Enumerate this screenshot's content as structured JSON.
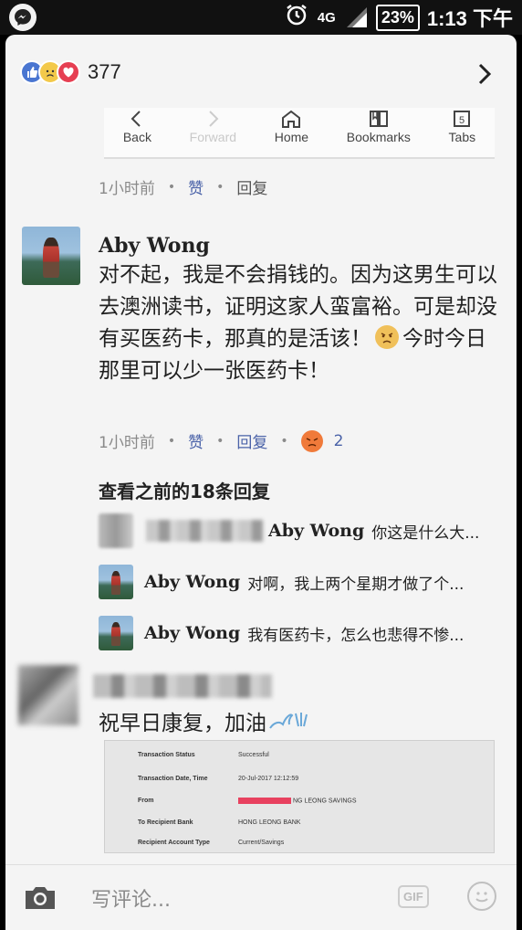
{
  "status_bar": {
    "network": "4G",
    "battery": "23%",
    "time": "1:13 下午"
  },
  "reactions": {
    "count": "377",
    "icons": [
      "like-icon",
      "sad-icon",
      "love-icon"
    ]
  },
  "browser_bar": {
    "back": "Back",
    "forward": "Forward",
    "home": "Home",
    "bookmarks": "Bookmarks",
    "tabs": "Tabs",
    "tab_count": "5"
  },
  "meta1": {
    "time": "1小时前",
    "like": "赞",
    "reply": "回复"
  },
  "comment1": {
    "author": "Aby Wong",
    "text_part1": "对不起，我是不会捐钱的。因为这男生可以去澳洲读书，证明这家人蛮富裕。可是却没有买医药卡，那真的是活该！",
    "text_part2": "今时今日那里可以少一张医药卡！",
    "meta": {
      "time": "1小时前",
      "like": "赞",
      "reply": "回复",
      "reaction_count": "2"
    }
  },
  "replies": {
    "see_previous": "查看之前的18条回复",
    "items": [
      {
        "name": "Aby Wong",
        "text": "你这是什么大..."
      },
      {
        "name": "Aby Wong",
        "text": "对啊，我上两个星期才做了个..."
      },
      {
        "name": "Aby Wong",
        "text": "我有医药卡，怎么也悲得不惨..."
      }
    ]
  },
  "comment2": {
    "text": "祝早日康复，加油"
  },
  "receipt": {
    "rows": [
      {
        "label": "Transaction Status",
        "value": "Successful"
      },
      {
        "label": "Transaction Date, Time",
        "value": "20-Jul-2017 12:12:59"
      },
      {
        "label": "From",
        "value": "NG LEONG SAVINGS"
      },
      {
        "label": "To Recipient Bank",
        "value": "HONG LEONG BANK"
      },
      {
        "label": "Recipient Account Type",
        "value": "Current/Savings"
      }
    ]
  },
  "composer": {
    "placeholder": "写评论...",
    "gif": "GIF"
  }
}
